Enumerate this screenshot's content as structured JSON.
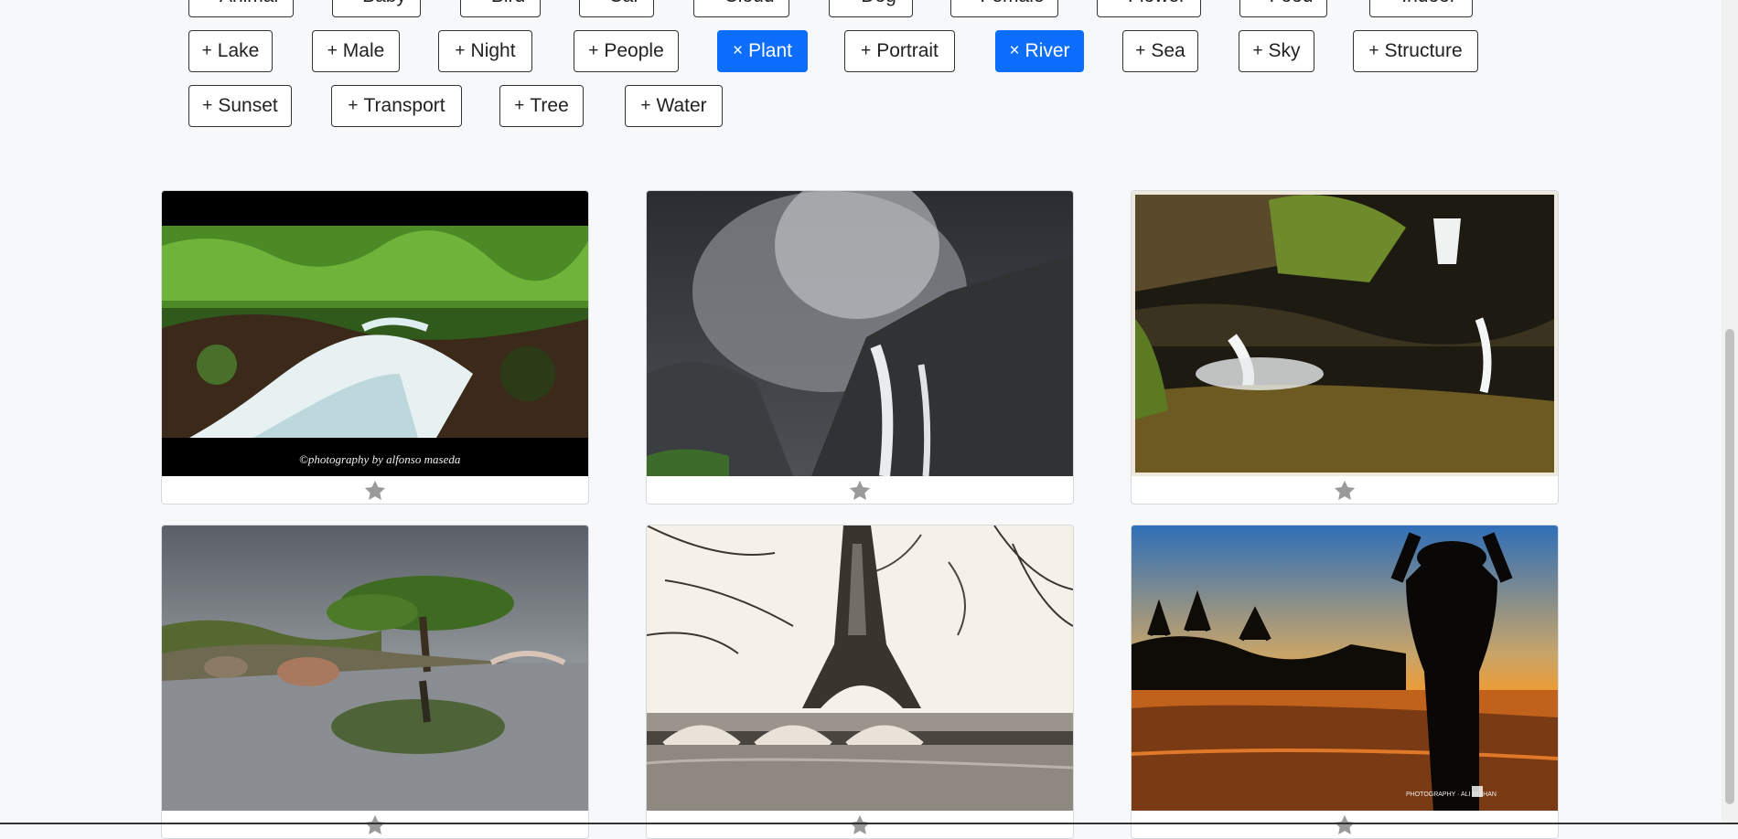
{
  "tag_rows": [
    [
      {
        "symbol": "+",
        "label": "Animal",
        "active": false
      },
      {
        "symbol": "+",
        "label": "Baby",
        "active": false
      },
      {
        "symbol": "+",
        "label": "Bird",
        "active": false
      },
      {
        "symbol": "+",
        "label": "Car",
        "active": false
      },
      {
        "symbol": "+",
        "label": "Cloud",
        "active": false
      },
      {
        "symbol": "+",
        "label": "Dog",
        "active": false
      },
      {
        "symbol": "+",
        "label": "Female",
        "active": false
      },
      {
        "symbol": "+",
        "label": "Flower",
        "active": false
      },
      {
        "symbol": "+",
        "label": "Food",
        "active": false
      },
      {
        "symbol": "+",
        "label": "Indoor",
        "active": false
      }
    ],
    [
      {
        "symbol": "+",
        "label": "Lake",
        "active": false
      },
      {
        "symbol": "+",
        "label": "Male",
        "active": false
      },
      {
        "symbol": "+",
        "label": "Night",
        "active": false
      },
      {
        "symbol": "+",
        "label": "People",
        "active": false
      },
      {
        "symbol": "×",
        "label": "Plant",
        "active": true
      },
      {
        "symbol": "+",
        "label": "Portrait",
        "active": false
      },
      {
        "symbol": "×",
        "label": "River",
        "active": true
      },
      {
        "symbol": "+",
        "label": "Sea",
        "active": false
      },
      {
        "symbol": "+",
        "label": "Sky",
        "active": false
      },
      {
        "symbol": "+",
        "label": "Structure",
        "active": false
      }
    ],
    [
      {
        "symbol": "+",
        "label": "Sunset",
        "active": false
      },
      {
        "symbol": "+",
        "label": "Transport",
        "active": false
      },
      {
        "symbol": "+",
        "label": "Tree",
        "active": false
      },
      {
        "symbol": "+",
        "label": "Water",
        "active": false
      }
    ]
  ],
  "photos": [
    {
      "scene": "forest-stream",
      "watermark": "©photography by alfonso maseda"
    },
    {
      "scene": "misty-waterfall",
      "watermark": ""
    },
    {
      "scene": "mossy-cascade",
      "watermark": ""
    },
    {
      "scene": "tree-reflection-lake",
      "watermark": ""
    },
    {
      "scene": "eiffel-tower-bridge",
      "watermark": ""
    },
    {
      "scene": "sunset-silhouette-goggles",
      "watermark": "PHOTOGRAPHY · ALI NISHAN"
    }
  ],
  "favorite_icon": "star-icon",
  "colors": {
    "accent": "#0d6efd",
    "star": "#9a9a9a"
  }
}
